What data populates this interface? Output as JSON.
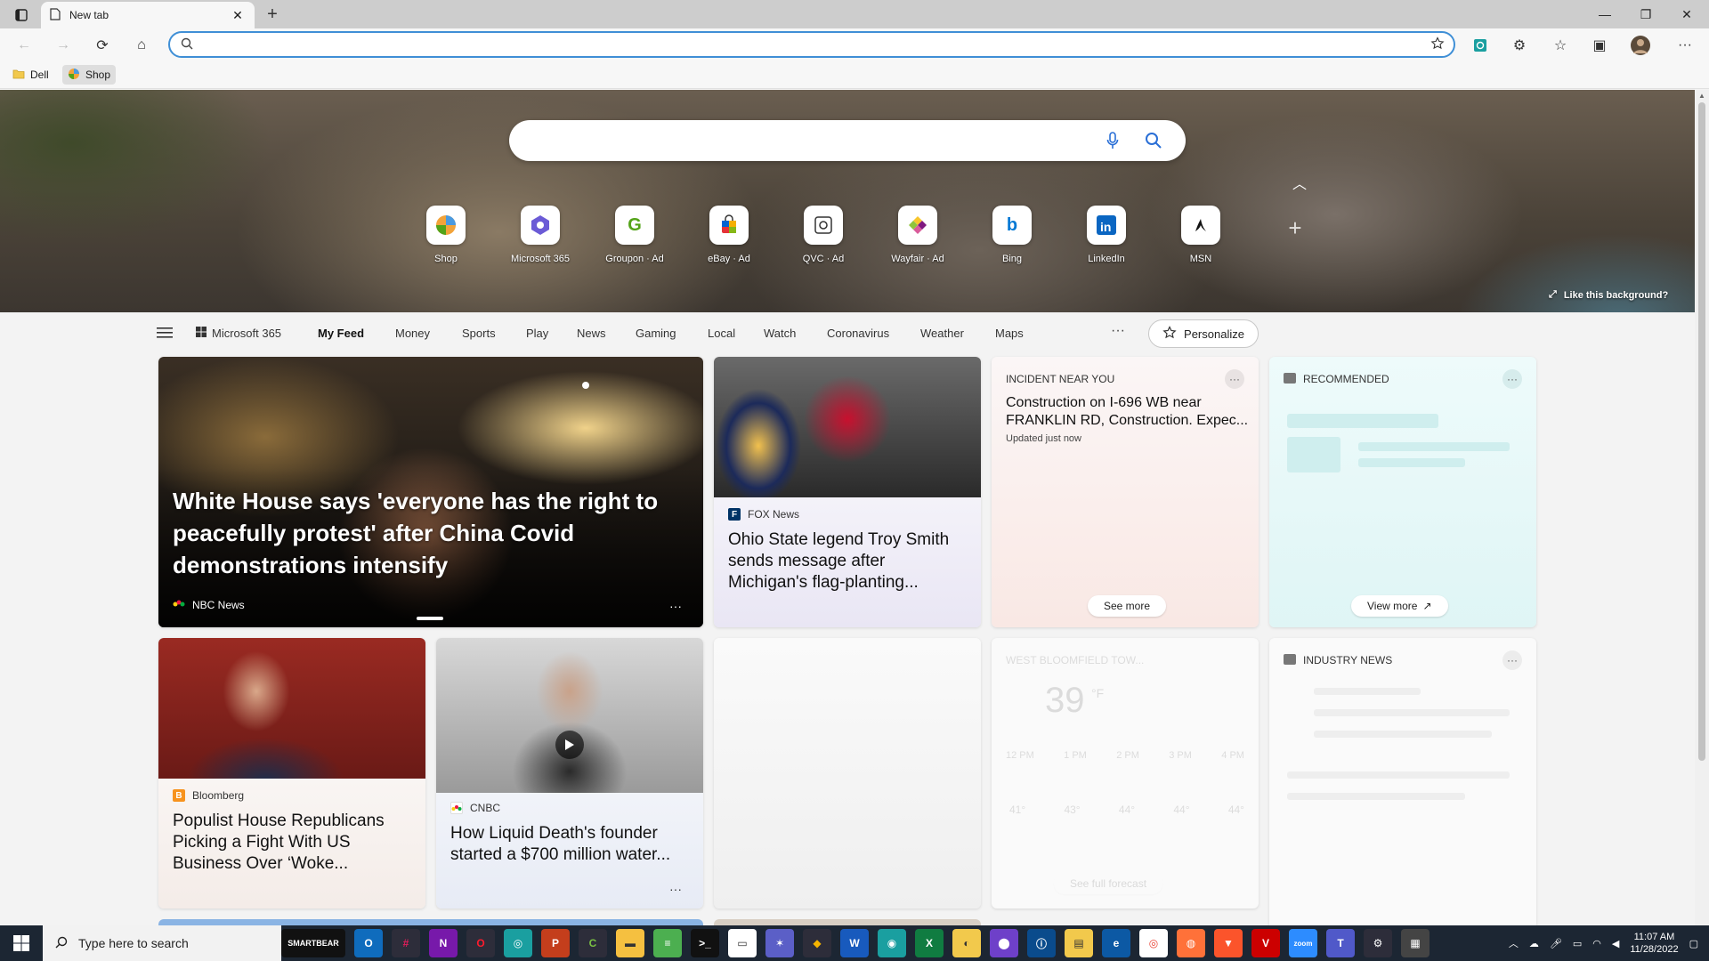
{
  "browser": {
    "tab_title": "New tab",
    "address_value": "",
    "address_placeholder": ""
  },
  "favorites": [
    {
      "label": "Dell",
      "icon": "folder-icon"
    },
    {
      "label": "Shop",
      "icon": "shop-icon"
    }
  ],
  "hero": {
    "search_value": "",
    "like_background": "Like this background?",
    "tiles": [
      {
        "label": "Shop",
        "icon": "shop-icon",
        "color": "#f2a33a"
      },
      {
        "label": "Microsoft 365",
        "icon": "microsoft-365-icon",
        "color": "#6b5bd6"
      },
      {
        "label": "Groupon · Ad",
        "icon": "groupon-icon",
        "color": "#53a318"
      },
      {
        "label": "eBay · Ad",
        "icon": "ebay-icon",
        "color": "#e53238"
      },
      {
        "label": "QVC · Ad",
        "icon": "qvc-icon",
        "color": "#333333"
      },
      {
        "label": "Wayfair · Ad",
        "icon": "wayfair-icon",
        "color": "#7f187f"
      },
      {
        "label": "Bing",
        "icon": "bing-icon",
        "color": "#0078d4"
      },
      {
        "label": "LinkedIn",
        "icon": "linkedin-icon",
        "color": "#0a66c2"
      },
      {
        "label": "MSN",
        "icon": "msn-icon",
        "color": "#111111"
      }
    ]
  },
  "feed_nav": {
    "microsoft365": "Microsoft 365",
    "items": [
      "My Feed",
      "Money",
      "Sports",
      "Play",
      "News",
      "Gaming",
      "Local",
      "Watch",
      "Coronavirus",
      "Weather",
      "Maps"
    ],
    "more": "···",
    "personalize": "Personalize"
  },
  "cards": {
    "hero": {
      "headline": "White House says 'everyone has the right to peacefully protest' after China Covid demonstrations intensify",
      "source": "NBC News",
      "more": "···"
    },
    "fox": {
      "source": "FOX News",
      "title": "Ohio State legend Troy Smith sends message after Michigan's flag-planting..."
    },
    "incident": {
      "label": "INCIDENT NEAR YOU",
      "title": "Construction on I-696 WB near FRANKLIN RD, Construction. Expec...",
      "updated": "Updated just now",
      "see_more": "See more",
      "more": "···"
    },
    "recommended": {
      "label": "RECOMMENDED",
      "view_more": "View more",
      "more": "···"
    },
    "bloomberg": {
      "source": "Bloomberg",
      "title": "Populist House Republicans Picking a Fight With US Business Over ‘Woke..."
    },
    "cnbc": {
      "source": "CNBC",
      "title": "How Liquid Death's founder started a $700 million water...",
      "more": "···"
    },
    "industry": {
      "label": "INDUSTRY NEWS",
      "more": "···"
    },
    "weather": {
      "location": "WEST BLOOMFIELD TOW...",
      "temp": "39",
      "unit": "°F",
      "hours": [
        "12 PM",
        "1 PM",
        "2 PM",
        "3 PM",
        "4 PM"
      ],
      "temps": [
        "41°",
        "43°",
        "44°",
        "44°",
        "44°"
      ],
      "forecast": "See full forecast"
    }
  },
  "taskbar": {
    "search_placeholder": "Type here to search",
    "smartbear": "SMARTBEAR",
    "time": "11:07 AM",
    "date": "11/28/2022"
  }
}
